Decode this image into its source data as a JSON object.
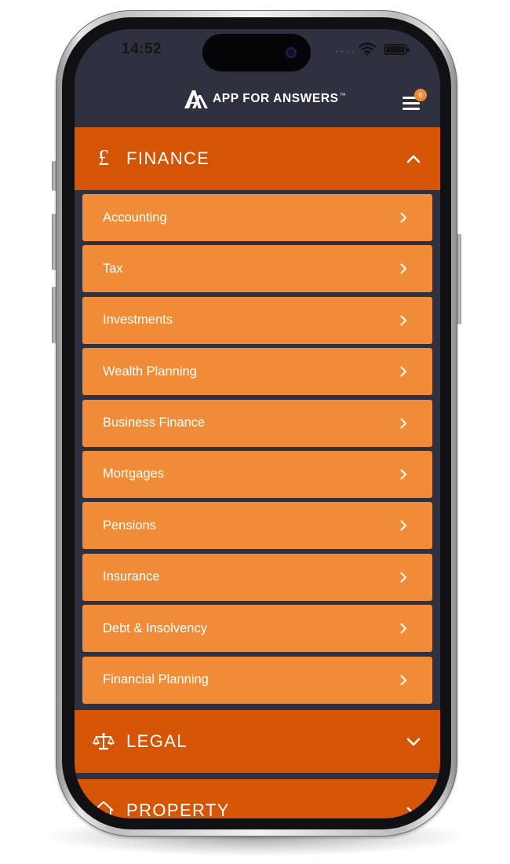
{
  "status_bar": {
    "time": "14:52",
    "signal_icon": "cellular-signal-icon",
    "wifi_icon": "wifi-icon",
    "battery_icon": "battery-icon"
  },
  "header": {
    "brand_name": "APP FOR ANSWERS",
    "brand_tm": "™",
    "logo_icon": "aa-monogram-logo",
    "menu_icon": "hamburger-menu-icon",
    "notification_count": "6"
  },
  "categories": [
    {
      "title": "FINANCE",
      "icon": "pound-sign-icon",
      "icon_glyph": "£",
      "expanded": true,
      "items": [
        {
          "label": "Accounting"
        },
        {
          "label": "Tax"
        },
        {
          "label": "Investments"
        },
        {
          "label": "Wealth Planning"
        },
        {
          "label": "Business Finance"
        },
        {
          "label": "Mortgages"
        },
        {
          "label": "Pensions"
        },
        {
          "label": "Insurance"
        },
        {
          "label": "Debt & Insolvency"
        },
        {
          "label": "Financial Planning"
        }
      ]
    },
    {
      "title": "LEGAL",
      "icon": "scales-of-justice-icon",
      "expanded": false
    },
    {
      "title": "PROPERTY",
      "icon": "house-icon",
      "expanded": false
    }
  ],
  "colors": {
    "background_dark": "#2f3140",
    "category_orange": "#d55406",
    "item_orange": "#f08c37",
    "badge_orange": "#ef8a36",
    "text": "#ffffff"
  }
}
